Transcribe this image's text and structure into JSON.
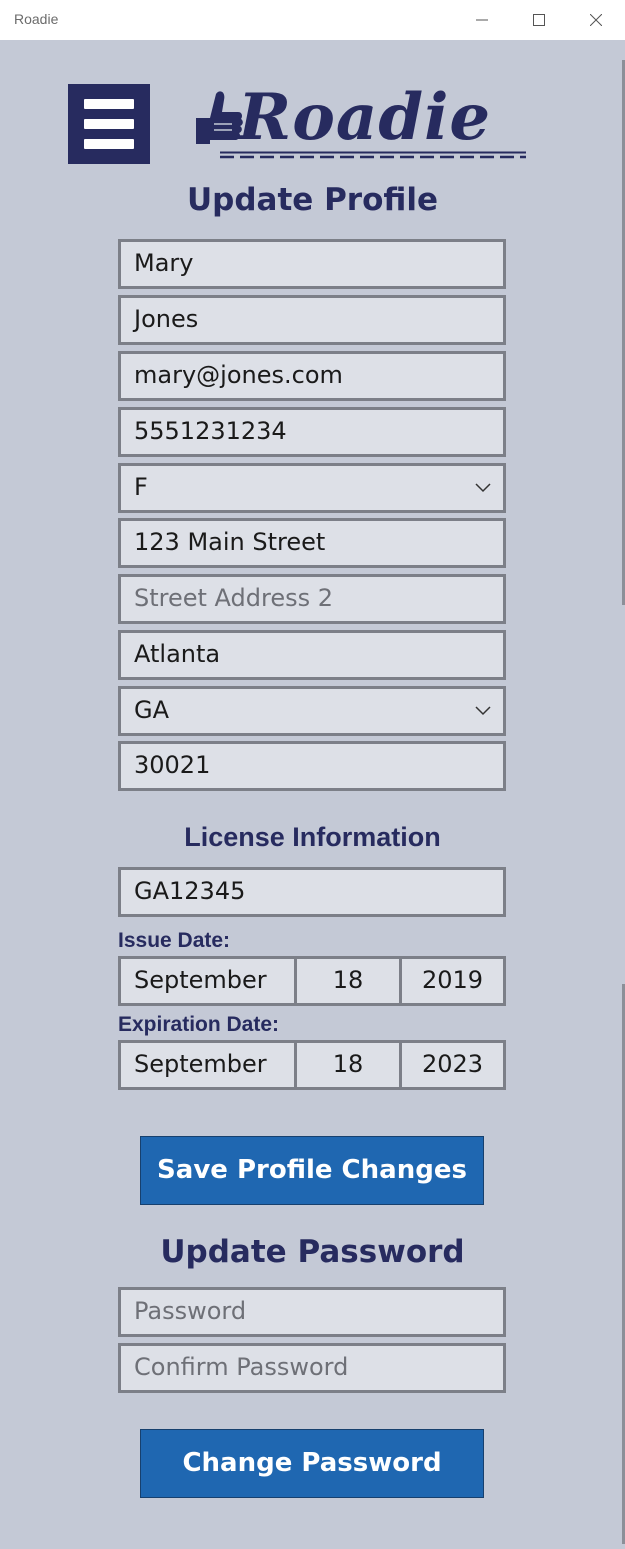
{
  "window": {
    "title": "Roadie"
  },
  "logo": {
    "text": "Roadie"
  },
  "profile": {
    "heading": "Update Profile",
    "first_name": "Mary",
    "last_name": "Jones",
    "email": "mary@jones.com",
    "phone": "5551231234",
    "gender": "F",
    "address1": "123 Main Street",
    "address2_placeholder": "Street Address 2",
    "city": "Atlanta",
    "state": "GA",
    "zip": "30021"
  },
  "license": {
    "heading": "License Information",
    "number": "GA12345",
    "issue_label": "Issue Date:",
    "issue": {
      "month": "September",
      "day": "18",
      "year": "2019"
    },
    "expiration_label": "Expiration Date:",
    "expiration": {
      "month": "September",
      "day": "18",
      "year": "2023"
    }
  },
  "buttons": {
    "save": "Save Profile Changes",
    "change_password": "Change Password"
  },
  "password": {
    "heading": "Update Password",
    "password_placeholder": "Password",
    "confirm_placeholder": "Confirm Password"
  },
  "colors": {
    "background": "#c4c9d6",
    "brand_navy": "#272b5f",
    "button_blue": "#1f67b1",
    "field_bg": "#dde0e7",
    "field_border": "#7c7f88"
  },
  "icons": [
    "minimize-icon",
    "maximize-icon",
    "close-icon",
    "hamburger-menu-icon",
    "thumbs-up-icon",
    "chevron-down-icon"
  ]
}
